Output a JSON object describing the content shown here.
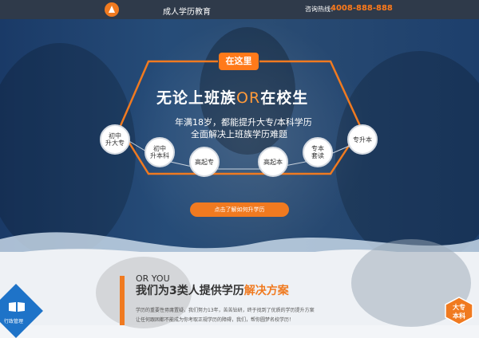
{
  "header": {
    "brand": "成人学历教育",
    "hotline_label": "咨询热线：",
    "phone": "4008-888-888"
  },
  "hero": {
    "badge": "在这里",
    "headline_part1": "无论上班族",
    "headline_or": "OR",
    "headline_part2": "在校生",
    "sub1": "年满18岁，都能提升大专/本科学历",
    "sub2": "全面解决上班族学历难题",
    "circles": [
      {
        "line1": "初中",
        "line2": "升大专"
      },
      {
        "line1": "初中",
        "line2": "升本科"
      },
      {
        "line1": "高起专",
        "line2": ""
      },
      {
        "line1": "高起本",
        "line2": ""
      },
      {
        "line1": "专本",
        "line2": "套读"
      },
      {
        "line1": "专升本",
        "line2": ""
      }
    ],
    "cta": "点击了解如何升学历"
  },
  "section": {
    "kicker": "OR YOU",
    "title_main": "我们为3类人提供学历",
    "title_highlight": "解决方案",
    "line1": "学历的重要性毋庸置疑，我们努力13年，苦苦钻研，终于找到了优质的学历提升方案",
    "line2": "让任何跟困都不能成为你考取正规学历的障碍，我们，帮你圆梦名校学历！"
  },
  "corner_left": {
    "label": "行政管理"
  },
  "corner_right": {
    "line1": "大专",
    "line2": "本科"
  },
  "colors": {
    "accent": "#f07a20",
    "topbar": "#2f3a4a",
    "hero": "#264c78"
  }
}
